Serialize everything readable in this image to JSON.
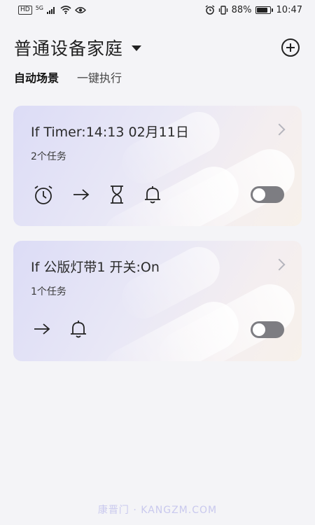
{
  "status_bar": {
    "left_tag": "HD",
    "signal_label": "5G",
    "battery_pct": "88%",
    "battery_level": 0.88,
    "time": "10:47"
  },
  "header": {
    "home_name": "普通设备家庭"
  },
  "tabs": [
    {
      "label": "自动场景",
      "active": true
    },
    {
      "label": "一键执行",
      "active": false
    }
  ],
  "scenes": [
    {
      "title": "If Timer:14:13 02月11日",
      "task_count": "2个任务",
      "icons": [
        "stopwatch-icon",
        "arrow-right-icon",
        "hourglass-icon",
        "bell-icon"
      ],
      "enabled": false
    },
    {
      "title": "If 公版灯带1 开关:On",
      "task_count": "1个任务",
      "icons": [
        "arrow-right-icon",
        "bell-icon"
      ],
      "enabled": false
    }
  ],
  "watermark": "康晋门 · KANGZM.COM"
}
